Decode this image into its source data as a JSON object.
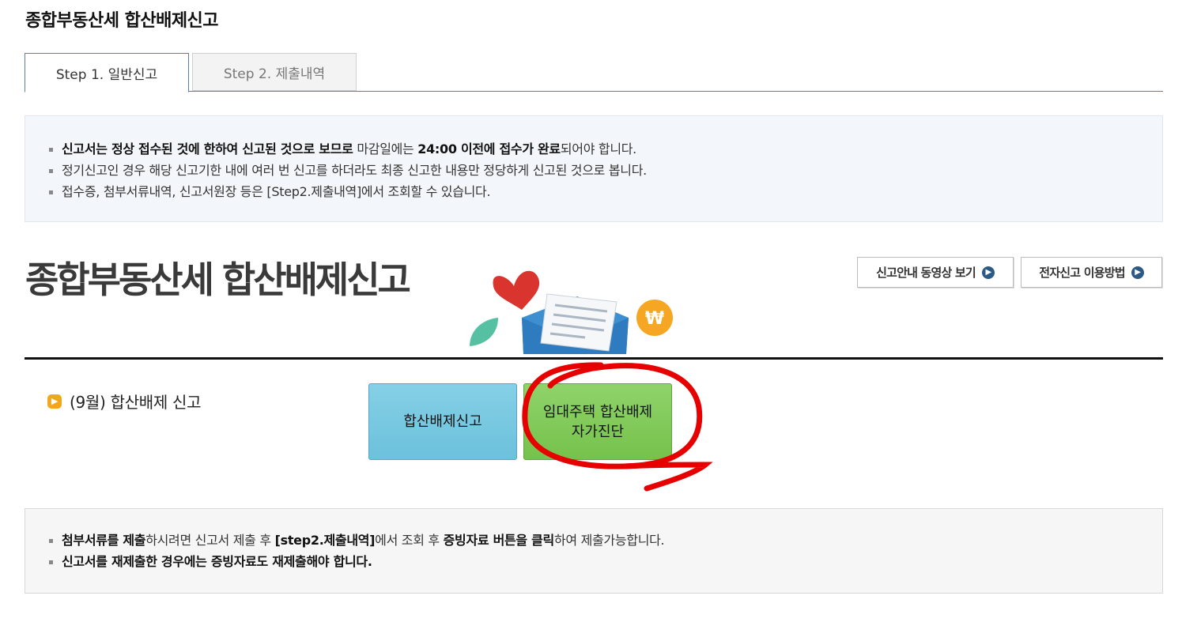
{
  "page": {
    "title": "종합부동산세 합산배제신고"
  },
  "tabs": [
    {
      "label": "Step 1. 일반신고",
      "active": true
    },
    {
      "label": "Step 2. 제출내역",
      "active": false
    }
  ],
  "notice_top": {
    "line1": {
      "bold": "신고서는 정상 접수된 것에 한하여 신고된 것으로 보므로",
      "normal1": " 마감일에는 ",
      "bold2": "24:00 이전에 접수가 완료",
      "normal2": "되어야 합니다."
    },
    "line2": "정기신고인 경우 해당 신고기한 내에 여러 번 신고를 하더라도 최종 신고한 내용만 정당하게 신고된 것으로 봅니다.",
    "line3": "접수증, 첨부서류내역, 신고서원장 등은 [Step2.제출내역]에서 조회할 수 있습니다."
  },
  "hero": {
    "title": "종합부동산세 합산배제신고",
    "illustration_icons": [
      "heart-icon",
      "leaf-icon",
      "envelope-icon",
      "document-icon",
      "won-coin-icon"
    ]
  },
  "top_buttons": {
    "video": {
      "label": "신고안내 동영상 보기",
      "icon": "arrow-circle-icon"
    },
    "guide": {
      "label": "전자신고 이용방법",
      "icon": "arrow-circle-icon"
    }
  },
  "section": {
    "label": "(9월) 합산배제 신고"
  },
  "actions": {
    "combine": {
      "label": "합산배제신고",
      "color": "#6cc1dc"
    },
    "selfcheck": {
      "label": "임대주택 합산배제\n자가진단",
      "color": "#76c24c"
    }
  },
  "annotation": {
    "color": "#e60000"
  },
  "notice_bottom": {
    "line1": {
      "bold1": "첨부서류를 제출",
      "normal1": "하시려면 신고서 제출 후 ",
      "bold2": "[step2.제출내역]",
      "normal2": "에서 조회 후 ",
      "bold3": "증빙자료 버튼을 클릭",
      "normal3": "하여 제출가능합니다."
    },
    "line2": "신고서를 재제출한 경우에는 증빙자료도 재제출해야 합니다."
  }
}
